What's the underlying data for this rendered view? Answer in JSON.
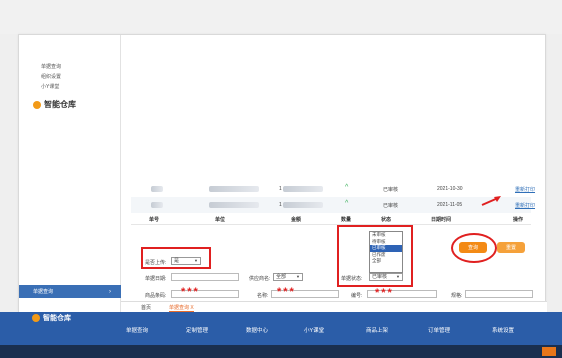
{
  "sidebar": {
    "items": [
      "单据查询",
      "组织设置",
      "小Y课堂"
    ],
    "main_label": "智能仓库",
    "selected": "单据查询"
  },
  "table": {
    "rows": [
      {
        "col4": "1",
        "status": "已审核",
        "time": "2021-10-30",
        "link": "重新打印"
      },
      {
        "col4": "1",
        "status": "已审核",
        "time": "2021-11-05",
        "link": "重新打印"
      }
    ],
    "headers": [
      "单号",
      "单位",
      "金额",
      "数量",
      "状态",
      "日期时间",
      "操作"
    ]
  },
  "status_dropdown": {
    "options": [
      "未审核",
      "待审核",
      "已审核",
      "已作废",
      "全部"
    ],
    "selected_index": 2
  },
  "form": {
    "is_uploaded_label": "是否上传:",
    "is_uploaded_value": "是",
    "query_time_label": "单据日期:",
    "supplier_label": "供应商名:",
    "supplier_value": "全部",
    "status_label": "单据状态:",
    "status_value": "已审核",
    "barcode_label": "商品条码:",
    "barcode_mask": "***",
    "name_label": "名称:",
    "name_mask": "***",
    "code_label": "编号:",
    "code_mask": "***",
    "spec_label": "规格:"
  },
  "buttons": {
    "query": "查询",
    "reset": "重置"
  },
  "tabs": [
    "首页",
    "单据查询 X"
  ],
  "bottom_nav": {
    "left_label": "智能仓库",
    "items": [
      "单据查询",
      "定制管理",
      "数据中心",
      "小Y课堂",
      "商品上架",
      "订单管理",
      "系统设置"
    ]
  },
  "colors": {
    "accent": "#f38a15",
    "nav": "#2b5da8",
    "highlight": "#e02020",
    "selected_blue": "#3a6fb5"
  }
}
